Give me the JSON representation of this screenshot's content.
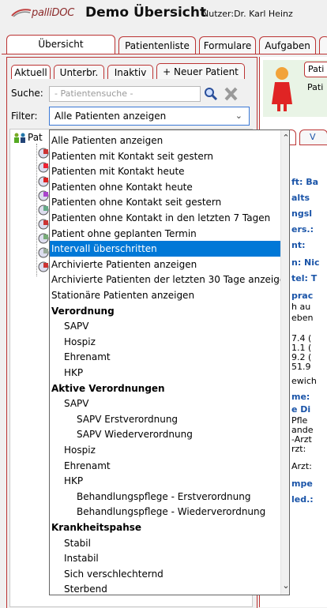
{
  "app": {
    "logo_text": "palliDOC",
    "title": "Demo Übersicht",
    "user": "Nutzer:Dr. Karl Heinz"
  },
  "main_tabs": [
    "Übersicht",
    "Patientenliste",
    "Formulare",
    "Aufgaben"
  ],
  "sub_tabs": [
    "Aktuell",
    "Unterbr.",
    "Inaktiv",
    "+ Neuer Patient"
  ],
  "search": {
    "label": "Suche:",
    "placeholder": "- Patientensuche -"
  },
  "filter": {
    "label": "Filter:",
    "value": "Alle Patienten anzeigen"
  },
  "tree": {
    "root_label": "Pat"
  },
  "dropdown_items": [
    {
      "text": "Alle Patienten anzeigen"
    },
    {
      "text": "Patienten mit Kontakt seit gestern"
    },
    {
      "text": "Patienten mit Kontakt heute"
    },
    {
      "text": "Patienten ohne Kontakt heute"
    },
    {
      "text": "Patienten ohne Kontakt seit gestern"
    },
    {
      "text": "Patienten ohne Kontakt in den letzten 7 Tagen"
    },
    {
      "text": "Patient ohne geplanten Termin"
    },
    {
      "text": "Intervall überschritten",
      "selected": true
    },
    {
      "text": "Archivierte Patienten anzeigen"
    },
    {
      "text": "Archivierte Patienten der letzten 30 Tage anzeigen"
    },
    {
      "text": "Stationäre Patienten anzeigen"
    },
    {
      "text": "Verordnung",
      "bold": true
    },
    {
      "text": "SAPV",
      "indent": 1
    },
    {
      "text": "Hospiz",
      "indent": 1
    },
    {
      "text": "Ehrenamt",
      "indent": 1
    },
    {
      "text": "HKP",
      "indent": 1
    },
    {
      "text": "Aktive Verordnungen",
      "bold": true
    },
    {
      "text": "SAPV",
      "indent": 1
    },
    {
      "text": "SAPV Erstverordnung",
      "indent": 2
    },
    {
      "text": "SAPV Wiederverordnung",
      "indent": 2
    },
    {
      "text": "Hospiz",
      "indent": 1
    },
    {
      "text": "Ehrenamt",
      "indent": 1
    },
    {
      "text": "HKP",
      "indent": 1
    },
    {
      "text": "Behandlungspflege - Erstverordnung",
      "indent": 2
    },
    {
      "text": "Behandlungspflege - Wiederverordnung",
      "indent": 2
    },
    {
      "text": "Krankheitspahse",
      "bold": true
    },
    {
      "text": "Stabil",
      "indent": 1
    },
    {
      "text": "Instabil",
      "indent": 1
    },
    {
      "text": "Sich verschlechternd",
      "indent": 1
    },
    {
      "text": "Sterbend",
      "indent": 1
    }
  ],
  "right_panel": {
    "header_label": "Pati",
    "header_sub": "Pati",
    "tab_label": "V",
    "fragments": [
      {
        "text": "ft: Ba",
        "blue": true
      },
      {
        "text": "alts",
        "blue": true
      },
      {
        "text": "ngsl",
        "blue": true
      },
      {
        "text": "ers.:",
        "blue": true
      },
      {
        "text": "nt:",
        "blue": true
      },
      {
        "text": "n: Nic",
        "blue": true
      },
      {
        "text": "tel: T",
        "blue": true
      },
      {
        "text": "prac",
        "blue": true
      },
      {
        "text": "h au",
        "blue": false
      },
      {
        "text": "eben",
        "blue": false
      },
      {
        "text": "7.4 (",
        "blue": false
      },
      {
        "text": "1.1 (",
        "blue": false
      },
      {
        "text": "9.2 (",
        "blue": false
      },
      {
        "text": "51.9",
        "blue": false
      },
      {
        "text": "ewich",
        "blue": false
      },
      {
        "text": "me:",
        "blue": true
      },
      {
        "text": "e Di",
        "blue": true
      },
      {
        "text": "Pfle",
        "blue": false
      },
      {
        "text": "ande",
        "blue": false
      },
      {
        "text": "-Arzt",
        "blue": false
      },
      {
        "text": "rzt:",
        "blue": false
      },
      {
        "text": "Arzt:",
        "blue": false
      },
      {
        "text": "mpe",
        "blue": true
      },
      {
        "text": "led.:",
        "blue": true
      }
    ]
  }
}
